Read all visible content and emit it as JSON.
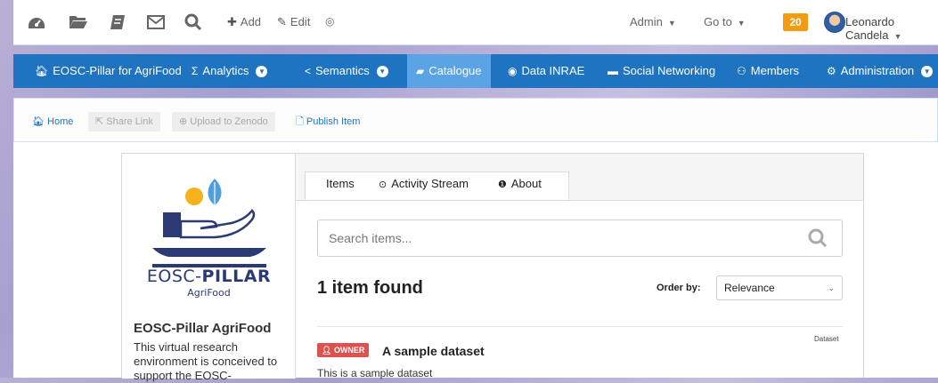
{
  "topbar": {
    "icons": [
      "dashboard-icon",
      "folder-icon",
      "book-icon",
      "mail-icon",
      "search-icon"
    ],
    "add_label": "Add",
    "edit_label": "Edit",
    "hide_icon": "eye-slash-icon",
    "admin_label": "Admin",
    "goto_label": "Go to",
    "notification_count": "20",
    "user_name": "Leonardo Candela"
  },
  "nav": {
    "items": [
      {
        "label": "EOSC-Pillar for AgriFood",
        "icon": "home-icon"
      },
      {
        "label": "Analytics",
        "icon": "sigma-icon"
      },
      {
        "label": "Semantics",
        "icon": "share-icon"
      },
      {
        "label": "Catalogue",
        "icon": "book-icon",
        "active": true
      },
      {
        "label": "Data INRAE",
        "icon": "compass-icon"
      },
      {
        "label": "Social Networking",
        "icon": "chat-icon"
      },
      {
        "label": "Members",
        "icon": "users-icon"
      },
      {
        "label": "Administration",
        "icon": "gear-icon"
      }
    ]
  },
  "breadcrumb": {
    "home": "Home",
    "share": "Share Link",
    "upload": "Upload to Zenodo",
    "publish": "Publish Item"
  },
  "organization": {
    "logo_prefix": "EOSC-",
    "logo_bold": "PILLAR",
    "logo_sub": "AgriFood",
    "name": "EOSC-Pillar AgriFood",
    "description": "This virtual research environment is conceived to support the EOSC-"
  },
  "tabs": {
    "items": "Items",
    "activity": "Activity Stream",
    "about": "About"
  },
  "search": {
    "placeholder": "Search items..."
  },
  "results": {
    "found": "1 item found",
    "order_label": "Order by:",
    "order_value": "Relevance"
  },
  "dataset": {
    "type": "Dataset",
    "badge": "OWNER",
    "title": "A sample dataset",
    "description": "This is a sample dataset"
  },
  "colors": {
    "nav_bg": "#1f74c2",
    "nav_active": "#5aa4e6",
    "badge_orange": "#f39c12",
    "owner_red": "#d9534f",
    "logo_navy": "#2b3a75"
  }
}
